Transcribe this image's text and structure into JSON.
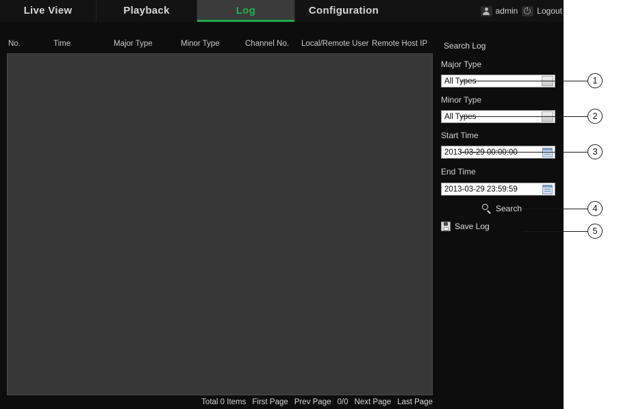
{
  "nav": {
    "tabs": [
      {
        "label": "Live View",
        "active": false
      },
      {
        "label": "Playback",
        "active": false
      },
      {
        "label": "Log",
        "active": true
      },
      {
        "label": "Configuration",
        "active": false
      }
    ]
  },
  "user": {
    "account_icon": "person-icon",
    "account_name": "admin",
    "logout_icon": "logout-icon",
    "logout_label": "Logout"
  },
  "table": {
    "columns": [
      "No.",
      "Time",
      "Major Type",
      "Minor Type",
      "Channel No.",
      "Local/Remote User",
      "Remote Host IP"
    ],
    "rows": []
  },
  "pagination": {
    "total": "Total 0 Items",
    "first_page": "First Page",
    "prev_page": "Prev Page",
    "page_indicator": "0/0",
    "next_page": "Next Page",
    "last_page": "Last Page"
  },
  "search_panel": {
    "title": "Search Log",
    "major_type": {
      "label": "Major Type",
      "value": "All Types",
      "icon": "dropdown-arrow-icon"
    },
    "minor_type": {
      "label": "Minor Type",
      "value": "All Types",
      "icon": "dropdown-arrow-icon"
    },
    "start_time": {
      "label": "Start Time",
      "value": "2013-03-29 00:00:00",
      "icon": "calendar-icon"
    },
    "end_time": {
      "label": "End Time",
      "value": "2013-03-29 23:59:59",
      "icon": "calendar-icon"
    },
    "search_button": {
      "label": "Search",
      "icon": "search-icon"
    },
    "save_log_button": {
      "label": "Save Log",
      "icon": "save-floppy-icon"
    }
  },
  "callouts": [
    {
      "number": "1",
      "target": "major-type-dropdown"
    },
    {
      "number": "2",
      "target": "minor-type-dropdown"
    },
    {
      "number": "3",
      "target": "start-time-field"
    },
    {
      "number": "4",
      "target": "search-button"
    },
    {
      "number": "5",
      "target": "save-log-button"
    }
  ],
  "colors": {
    "accent_green": "#1faa4b",
    "shell_background": "#0d0d0d",
    "table_background": "#373737",
    "field_background": "#fdfdfd"
  }
}
